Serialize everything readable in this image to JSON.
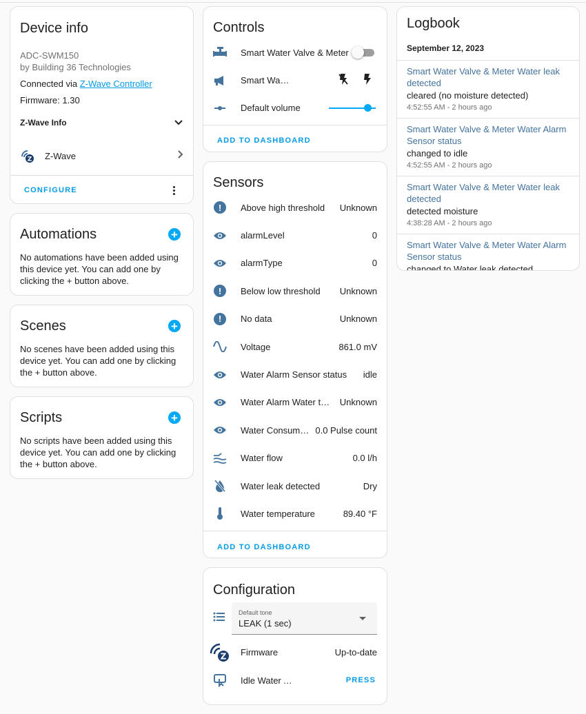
{
  "device_info": {
    "title": "Device info",
    "model": "ADC-SWM150",
    "manufacturer": "by Building 36 Technologies",
    "connected_prefix": "Connected via ",
    "connected_link": "Z-Wave Controller",
    "firmware": "Firmware: 1.30",
    "zwave_info_label": "Z-Wave Info",
    "zwave_label": "Z-Wave",
    "configure_label": "CONFIGURE"
  },
  "automations": {
    "title": "Automations",
    "text": "No automations have been added using this device yet. You can add one by clicking the + button above."
  },
  "scenes": {
    "title": "Scenes",
    "text": "No scenes have been added using this device yet. You can add one by clicking the + button above."
  },
  "scripts": {
    "title": "Scripts",
    "text": "No scripts have been added using this device yet. You can add one by clicking the + button above."
  },
  "controls": {
    "title": "Controls",
    "items": [
      {
        "label": "Smart Water Valve & Meter",
        "icon": "valve-icon"
      },
      {
        "label": "Smart Water Valve & Meter Siren",
        "icon": "bullhorn-icon"
      },
      {
        "label": "Default volume",
        "icon": "volume-slider-icon"
      }
    ],
    "volume_level": 0.9,
    "add_label": "ADD TO DASHBOARD"
  },
  "sensors": {
    "title": "Sensors",
    "items": [
      {
        "label": "Above high threshold",
        "value": "Unknown",
        "icon": "alert-circle-icon"
      },
      {
        "label": "alarmLevel",
        "value": "0",
        "icon": "eye-icon"
      },
      {
        "label": "alarmType",
        "value": "0",
        "icon": "eye-icon"
      },
      {
        "label": "Below low threshold",
        "value": "Unknown",
        "icon": "alert-circle-icon"
      },
      {
        "label": "No data",
        "value": "Unknown",
        "icon": "alert-circle-icon"
      },
      {
        "label": "Voltage",
        "value": "861.0 mV",
        "icon": "sine-wave-icon"
      },
      {
        "label": "Water Alarm Sensor status",
        "value": "idle",
        "icon": "eye-icon"
      },
      {
        "label": "Water Alarm Water temperature",
        "value": "Unknown",
        "icon": "eye-icon"
      },
      {
        "label": "Water Consumption",
        "value": "0.0 Pulse count",
        "icon": "eye-icon"
      },
      {
        "label": "Water flow",
        "value": "0.0 l/h",
        "icon": "water-flow-icon"
      },
      {
        "label": "Water leak detected",
        "value": "Dry",
        "icon": "water-off-icon"
      },
      {
        "label": "Water temperature",
        "value": "89.40 °F",
        "icon": "thermometer-icon"
      }
    ],
    "add_label": "ADD TO DASHBOARD"
  },
  "configuration": {
    "title": "Configuration",
    "tone_label": "Default tone",
    "tone_value": "LEAK (1 sec)",
    "firmware_label": "Firmware",
    "firmware_value": "Up-to-date",
    "idle_label": "Idle Water Alarm Sensor status",
    "press_label": "PRESS"
  },
  "logbook": {
    "title": "Logbook",
    "date": "September 12, 2023",
    "entries": [
      {
        "title": "Smart Water Valve & Meter Water leak detected",
        "message": "cleared (no moisture detected)",
        "time": "4:52:55 AM - 2 hours ago"
      },
      {
        "title": "Smart Water Valve & Meter Water Alarm Sensor status",
        "message": "changed to idle",
        "time": "4:52:55 AM - 2 hours ago"
      },
      {
        "title": "Smart Water Valve & Meter Water leak detected",
        "message": "detected moisture",
        "time": "4:38:28 AM - 2 hours ago"
      },
      {
        "title": "Smart Water Valve & Meter Water Alarm Sensor status",
        "message": "changed to Water leak detected",
        "time": ""
      }
    ]
  },
  "colors": {
    "accent": "#03a9f4",
    "icon": "#44739e",
    "log_link": "#44739e"
  }
}
